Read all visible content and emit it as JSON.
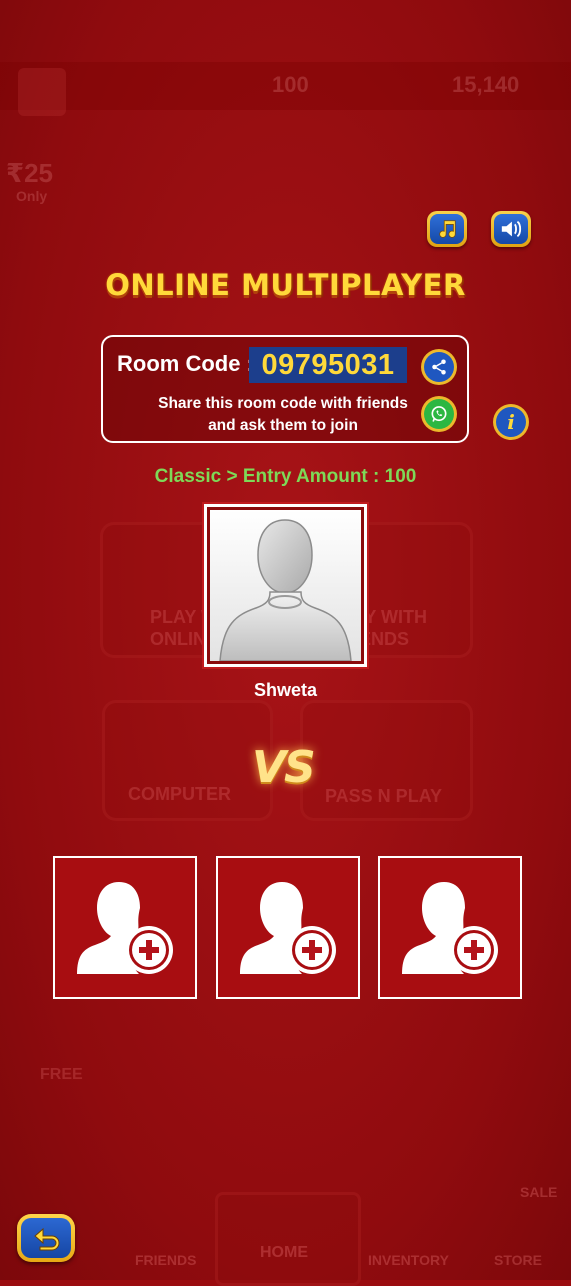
{
  "background": {
    "coins": "100",
    "gems": "15,140",
    "promo_price": "₹25",
    "promo_only": "Only",
    "ghost_play_online": "PLAY WITH ONLINE",
    "ghost_play_friends": "PLAY WITH FRIENDS",
    "ghost_computer": "COMPUTER",
    "ghost_pass_n_play": "PASS N PLAY",
    "ghost_free": "FREE",
    "nav_friends": "FRIENDS",
    "nav_home": "HOME",
    "nav_inventory": "INVENTORY",
    "nav_store": "STORE",
    "sale": "SALE"
  },
  "header": {
    "title": "ONLINE MULTIPLAYER",
    "music_icon": "music-note-icon",
    "sound_icon": "speaker-icon"
  },
  "room": {
    "label": "Room Code :",
    "code": "09795031",
    "share_text_line1": "Share this room code with friends",
    "share_text_line2": "and ask them to join"
  },
  "game_info": "Classic > Entry Amount : 100",
  "player": {
    "name": "Shweta"
  },
  "versus": "VS",
  "invite_slots": [
    {
      "icon": "add-user-icon"
    },
    {
      "icon": "add-user-icon"
    },
    {
      "icon": "add-user-icon"
    }
  ],
  "colors": {
    "accent_yellow": "#ffd93a",
    "green": "#7ed957",
    "bg_red": "#9b0c0f",
    "code_blue": "#1c3e8c"
  }
}
